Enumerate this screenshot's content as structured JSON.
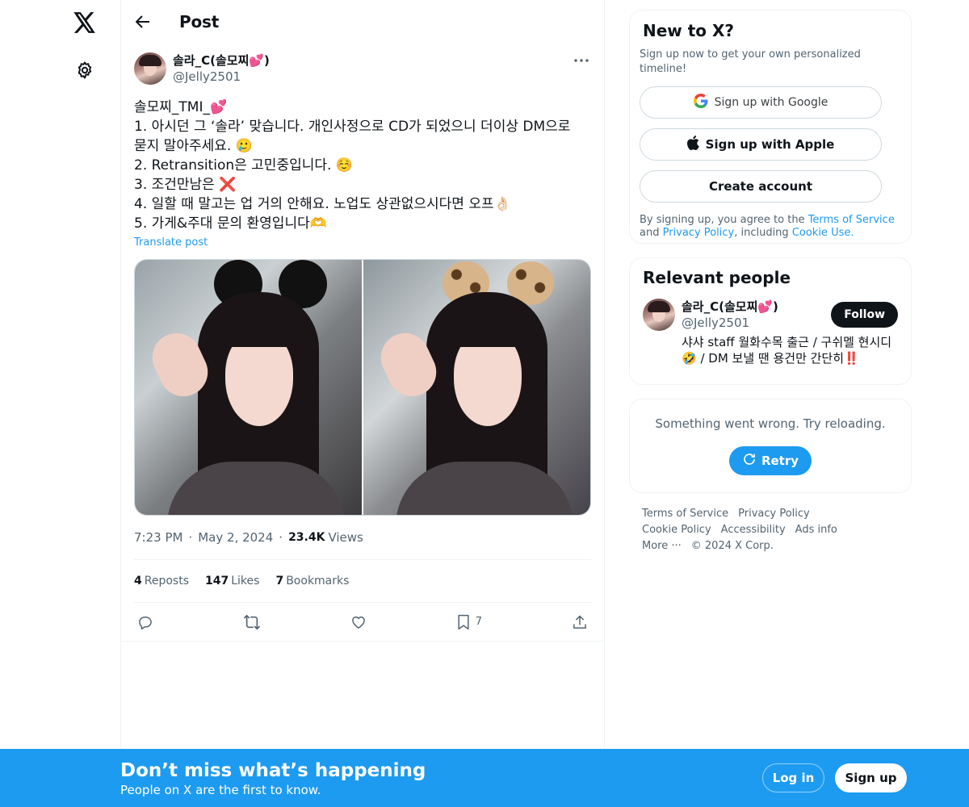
{
  "header": {
    "title": "Post"
  },
  "post": {
    "author_name": "솔라_C(솔모찌💕)",
    "author_handle": "@Jelly2501",
    "lines": [
      "솔모찌_TMI_💕",
      "1. 아시던 그 ‘솔라’ 맞습니다. 개인사정으로  CD가 되었으니 더이상 DM으로",
      "묻지 말아주세요. 🥲",
      "2. Retransition은 고민중입니다. ☺️",
      "3. 조건만남은 ❌",
      "4. 일할 때 말고는 업 거의 안해요. 노업도 상관없으시다면 오프👌🏻",
      "5. 가게&주대 문의 환영입니다🫶"
    ],
    "translate": "Translate post",
    "time": "7:23 PM",
    "date": "May 2, 2024",
    "views_count": "23.4K",
    "views_label": "Views",
    "reposts_count": "4",
    "reposts_label": "Reposts",
    "likes_count": "147",
    "likes_label": "Likes",
    "bookmarks_count": "7",
    "bookmarks_label": "Bookmarks",
    "bookmark_action_count": "7"
  },
  "sidebar": {
    "newto": {
      "title": "New to X?",
      "subtitle": "Sign up now to get your own personalized timeline!",
      "google": "Sign up with Google",
      "apple": "Sign up with Apple",
      "create": "Create account",
      "legal_1": "By signing up, you agree to the ",
      "terms": "Terms of Service",
      "legal_2": " and ",
      "privacy": "Privacy Policy",
      "legal_3": ", including ",
      "cookie": "Cookie Use",
      "legal_4": "."
    },
    "relevant": {
      "title": "Relevant people",
      "name": "솔라_C(솔모찌💕)",
      "handle": "@Jelly2501",
      "bio": "샤샤 staff 월화수목 출근 / 구쉬멜 현시디 🤣 / DM 보낼 땐 용건만 간단히‼️",
      "follow": "Follow"
    },
    "error": {
      "text": "Something went wrong. Try reloading.",
      "retry": "Retry"
    },
    "footer": [
      "Terms of Service",
      "Privacy Policy",
      "Cookie Policy",
      "Accessibility",
      "Ads info",
      "More ···",
      "© 2024 X Corp."
    ]
  },
  "bottombar": {
    "title": "Don’t miss what’s happening",
    "subtitle": "People on X are the first to know.",
    "login": "Log in",
    "signup": "Sign up"
  },
  "colors": {
    "accent": "#1d9bf0",
    "text": "#0f1419",
    "muted": "#536471"
  },
  "icons": [
    "x-logo-icon",
    "gear-icon",
    "back-arrow-icon",
    "more-icon",
    "reply-icon",
    "repost-icon",
    "like-icon",
    "bookmark-icon",
    "share-icon",
    "google-icon",
    "apple-icon",
    "refresh-icon"
  ]
}
